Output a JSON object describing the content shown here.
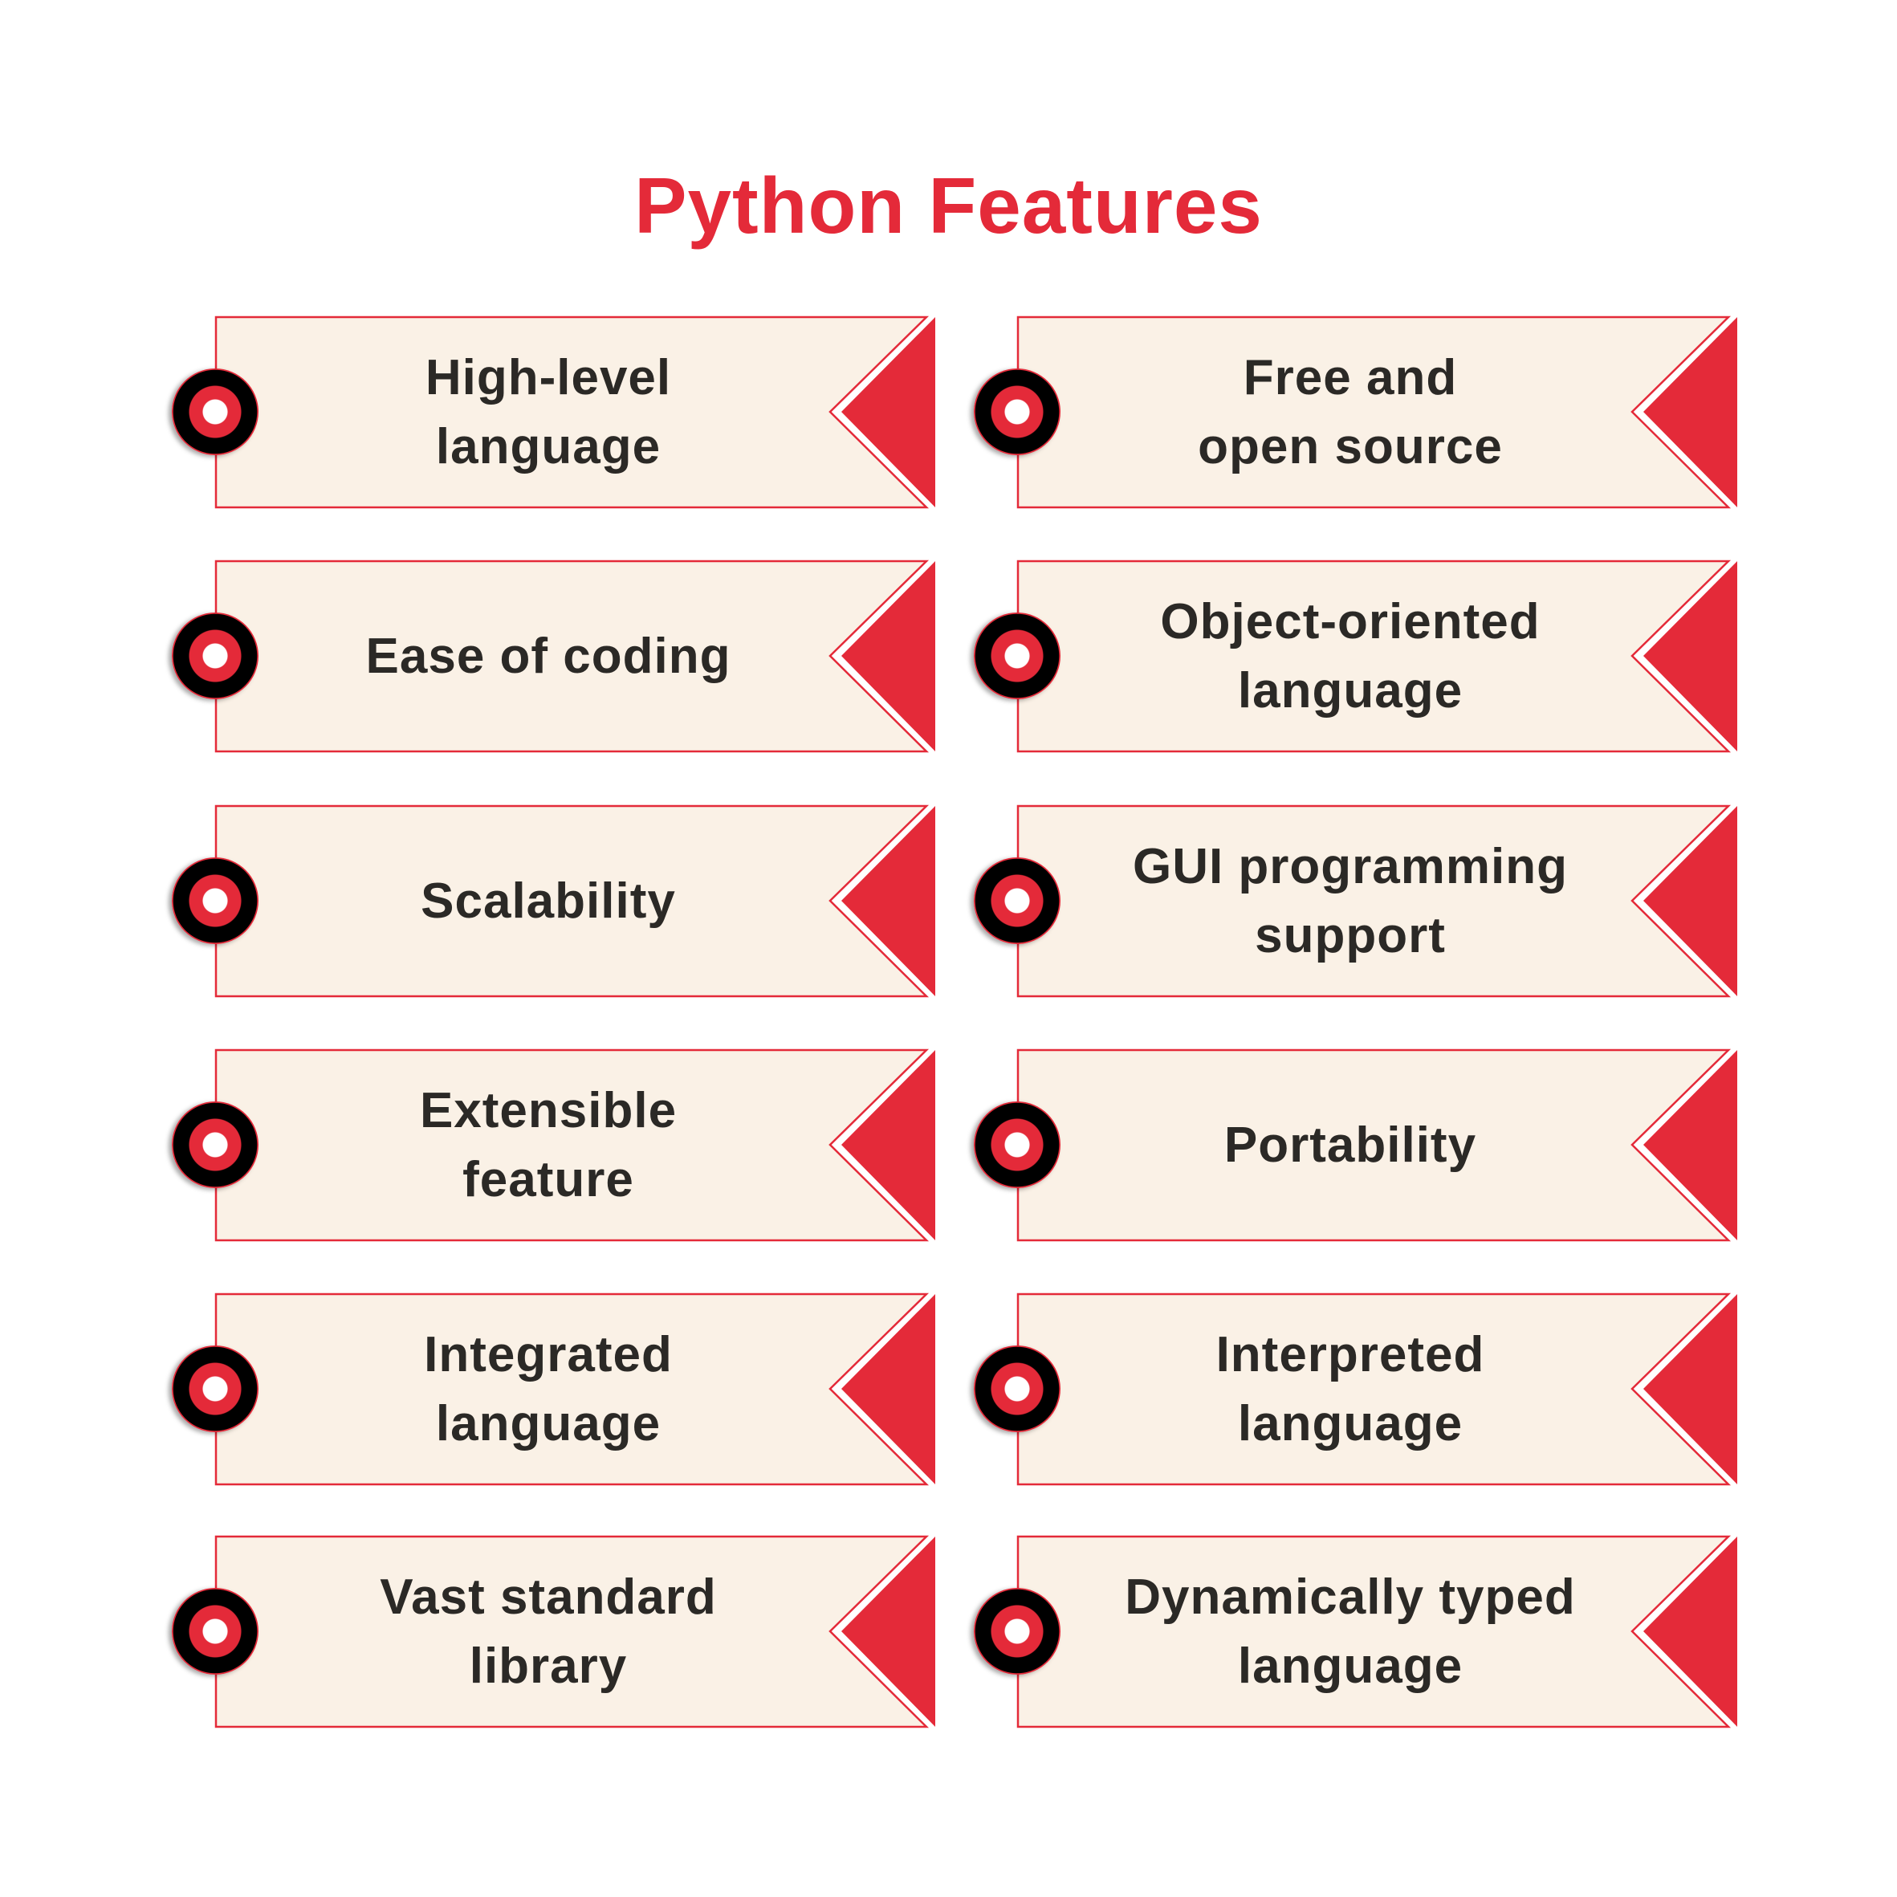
{
  "title": "Python Features",
  "colors": {
    "accent": "#E42A39",
    "card_bg": "#FAF1E6",
    "text": "#2B2926",
    "ring_outer": "#000000",
    "ring_inner": "#E42A39",
    "ring_center": "#FFFFFF"
  },
  "columns": [
    {
      "items": [
        {
          "label": "High-level\nlanguage"
        },
        {
          "label": "Ease of coding"
        },
        {
          "label": "Scalability"
        },
        {
          "label": "Extensible\nfeature"
        },
        {
          "label": "Integrated\nlanguage"
        },
        {
          "label": "Vast standard\nlibrary"
        }
      ]
    },
    {
      "items": [
        {
          "label": "Free and\nopen source"
        },
        {
          "label": "Object-oriented\nlanguage"
        },
        {
          "label": "GUI programming\nsupport"
        },
        {
          "label": "Portability"
        },
        {
          "label": "Interpreted\nlanguage"
        },
        {
          "label": "Dynamically typed\nlanguage"
        }
      ]
    }
  ]
}
